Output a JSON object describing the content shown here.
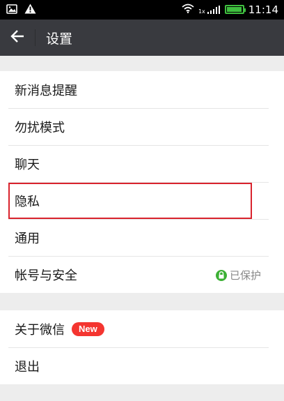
{
  "status_bar": {
    "time": "11:14",
    "network_label": "1x",
    "left_icons": [
      "image-icon",
      "warning-icon"
    ],
    "right_icons": [
      "wifi-icon",
      "signal-icon",
      "battery-icon"
    ],
    "battery_color": "#3fbf3f",
    "battery_level": 0.95
  },
  "header": {
    "title": "设置",
    "back_icon": "arrow-left-icon",
    "background": "#393a3f"
  },
  "settings": {
    "group1": [
      {
        "label": "新消息提醒"
      },
      {
        "label": "勿扰模式"
      },
      {
        "label": "聊天"
      },
      {
        "label": "隐私"
      },
      {
        "label": "通用"
      },
      {
        "label": "帐号与安全",
        "status": "已保护",
        "status_icon": "lock-icon",
        "status_color": "#3cb035"
      }
    ],
    "group2": [
      {
        "label": "关于微信",
        "badge": "New",
        "badge_color": "#f43530"
      },
      {
        "label": "退出"
      }
    ]
  },
  "highlight": {
    "target": "隐私",
    "color": "#d9232d"
  }
}
